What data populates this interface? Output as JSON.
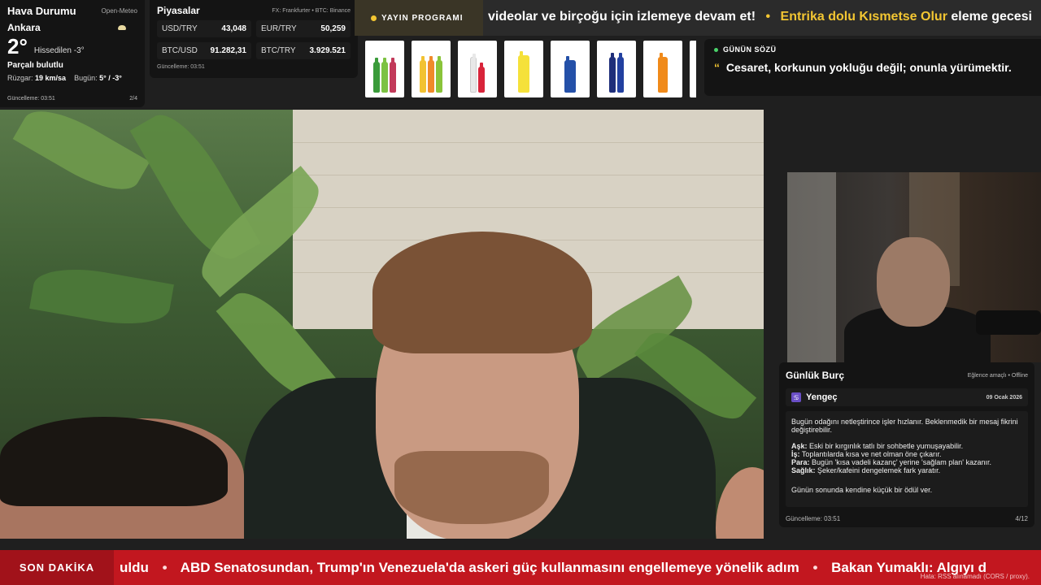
{
  "weather": {
    "title": "Hava Durumu",
    "source": "Open-Meteo",
    "city": "Ankara",
    "temperature": "2°",
    "feels_like": "Hissedilen -3°",
    "condition": "Parçalı bulutlu",
    "wind_label": "Rüzgar:",
    "wind_value": "19 km/sa",
    "today_label": "Bugün:",
    "today_value": "5° / -3°",
    "updated": "Güncelleme: 03:51",
    "page": "2/4",
    "icon": "partly-cloudy-icon"
  },
  "markets": {
    "title": "Piyasalar",
    "source": "FX: Frankfurter • BTC: Binance",
    "rows": [
      {
        "label": "USD/TRY",
        "value": "43,048"
      },
      {
        "label": "EUR/TRY",
        "value": "50,259"
      },
      {
        "label": "BTC/USD",
        "value": "91.282,31"
      },
      {
        "label": "BTC/TRY",
        "value": "3.929.521"
      }
    ],
    "updated": "Güncelleme: 03:51"
  },
  "ticker": {
    "badge": "YAYIN PROGRAMI",
    "text1": "videolar ve birçoğu için izlemeye devam et!",
    "separator": "•",
    "highlight": "Entrika dolu Kısmetse Olur",
    "text2": "eleme gecesi"
  },
  "quote": {
    "title": "GÜNÜN SÖZÜ",
    "mark": "“",
    "text": "Cesaret, korkunun yokluğu değil; onunla yürümektir."
  },
  "horoscope": {
    "title": "Günlük Burç",
    "tag": "Eğlence amaçlı • Offline",
    "sign": "Yengeç",
    "date": "09 Ocak 2026",
    "intro": "Bugün odağını netleştirince işler hızlanır. Beklenmedik bir mesaj fikrini değiştirebilir.",
    "love_label": "Aşk:",
    "love": "Eski bir kırgınlık tatlı bir sohbetle yumuşayabilir.",
    "work_label": "İş:",
    "work": "Toplantılarda kısa ve net olman öne çıkarır.",
    "money_label": "Para:",
    "money": "Bugün 'kısa vadeli kazanç' yerine 'sağlam plan' kazanır.",
    "health_label": "Sağlık:",
    "health": "Şeker/kafeini dengelemek fark yaratır.",
    "closing": "Günün sonunda kendine küçük bir ödül ver.",
    "updated": "Güncelleme: 03:51",
    "page": "4/12"
  },
  "breaking": {
    "label": "SON DAKİKA",
    "item0": "uldu",
    "separator": "•",
    "item1": "ABD Senatosundan, Trump'ın Venezuela'da askeri güç kullanmasını engellemeye yönelik adım",
    "item2": "Bakan Yumaklı: Algıyı d",
    "error": "Hata: RSS alınamadı (CORS / proxy)."
  },
  "colors": {
    "accent": "#f3c632",
    "breaking_red": "#c2171f",
    "panel": "#141414"
  }
}
